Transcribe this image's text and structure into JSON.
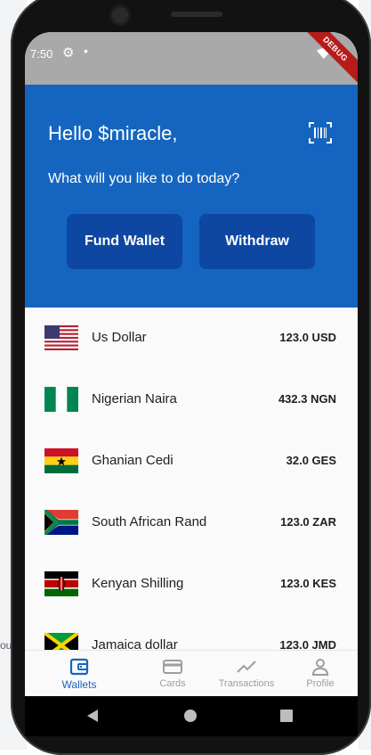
{
  "status_bar": {
    "time": "7:50",
    "icons": [
      "gear-icon",
      "dot-icon",
      "wifi-icon",
      "battery-icon"
    ],
    "debug_banner": "DEBUG"
  },
  "header": {
    "greeting": "Hello $miracle,",
    "subtitle": "What will you like to do today?",
    "fund_wallet_label": "Fund Wallet",
    "withdraw_label": "Withdraw",
    "scan_icon": "barcode-scan-icon",
    "background_color": "#1565c0",
    "button_color": "#0d47a1"
  },
  "wallets": [
    {
      "name": "Us Dollar",
      "amount": "123.0 USD",
      "flag": "us-flag"
    },
    {
      "name": "Nigerian Naira",
      "amount": "432.3 NGN",
      "flag": "nigeria-flag"
    },
    {
      "name": "Ghanian Cedi",
      "amount": "32.0 GES",
      "flag": "ghana-flag"
    },
    {
      "name": "South African Rand",
      "amount": "123.0 ZAR",
      "flag": "south-africa-flag"
    },
    {
      "name": "Kenyan Shilling",
      "amount": "123.0 KES",
      "flag": "kenya-flag"
    },
    {
      "name": "Jamaica dollar",
      "amount": "123.0 JMD",
      "flag": "jamaica-flag"
    }
  ],
  "bottom_nav": {
    "items": [
      {
        "label": "Wallets",
        "icon": "wallet-icon",
        "active": true
      },
      {
        "label": "Cards",
        "icon": "card-icon",
        "active": false
      },
      {
        "label": "Transactions",
        "icon": "chart-icon",
        "active": false
      },
      {
        "label": "Profile",
        "icon": "person-icon",
        "active": false
      }
    ]
  },
  "background_fragment": "ou"
}
